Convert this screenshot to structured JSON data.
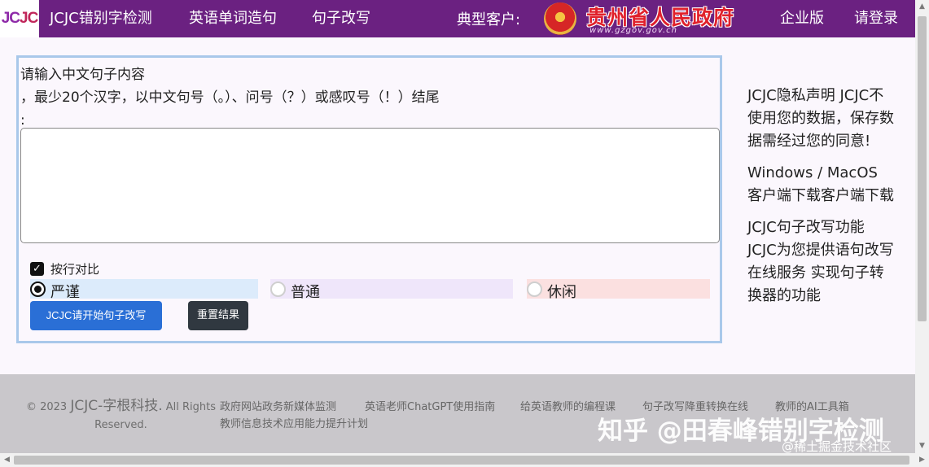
{
  "nav": {
    "logo_part1": "JC",
    "logo_part2": "JC",
    "links": [
      {
        "label": "JCJC错别字检测"
      },
      {
        "label": "英语单词造句"
      },
      {
        "label": "句子改写"
      }
    ],
    "customer_label": "典型客户:",
    "gov_name": "贵州省人民政府",
    "gov_url": "www.gzgov.gov.cn",
    "enterprise": "企业版",
    "login": "请登录"
  },
  "form": {
    "label_line1": "请输入中文句子内容",
    "label_line2": "，最少20个汉字，以中文句号（。）、问号（？）或感叹号（！）结尾",
    "label_line3": ":",
    "textarea_value": "",
    "checkbox_label": "按行对比",
    "checkbox_checked": true,
    "radios": [
      {
        "label": "严谨",
        "checked": true,
        "color": "#dcebfb"
      },
      {
        "label": "普通",
        "checked": false,
        "color": "#efe6fa"
      },
      {
        "label": "休闲",
        "checked": false,
        "color": "#fbe0e0"
      }
    ],
    "submit_label": "JCJC请开始句子改写",
    "reset_label": "重置结果"
  },
  "sidebar": {
    "privacy": "JCJC隐私声明 JCJC不使用您的数据，保存数据需经过您的同意!",
    "download": "Windows / MacOS 客户端下载客户端下载",
    "feature": "JCJC句子改写功能 JCJC为您提供语句改写在线服务 实现句子转换器的功能"
  },
  "footer": {
    "copyright_prefix": "© 2023",
    "brand": "JCJC-字根科技.",
    "rights": "All Rights Reserved.",
    "links": [
      "政府网站政务新媒体监测",
      "英语老师ChatGPT使用指南",
      "给英语教师的编程课",
      "句子改写降重转换在线",
      "教师的AI工具箱",
      "教师信息技术应用能力提升计划"
    ],
    "watermark": "知乎 @田春峰错别字检测",
    "watermark2": "@稀土掘金技术社区"
  },
  "colors": {
    "navbar": "#6b2181",
    "primary_button": "#2a6fd6",
    "dark_button": "#303840",
    "footer_bg": "#c9c7cb",
    "form_border": "#a9c8ea"
  }
}
